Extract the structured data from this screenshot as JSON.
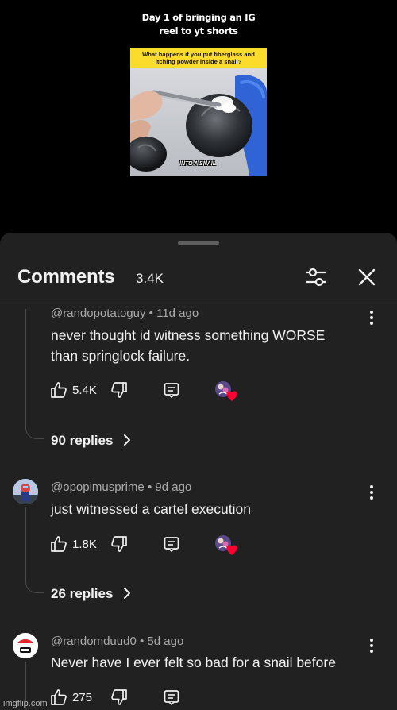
{
  "reel": {
    "title_line1": "Day 1 of bringing an IG",
    "title_line2": "reel to yt shorts",
    "caption_line1": "What happens if you put fiberglass and",
    "caption_line2": "itching powder inside a snail?",
    "subtitle": "INTO A SNAIL"
  },
  "comments_panel": {
    "title": "Comments",
    "count": "3.4K",
    "filter_icon": "sliders-icon",
    "close_icon": "close-icon"
  },
  "comments": [
    {
      "author": "@randopotatoguy",
      "separator": "•",
      "age": "11d ago",
      "text_line1": "never thought id witness something WORSE",
      "text_line2": "than springlock failure.",
      "likes": "5.4K",
      "replies": "90 replies"
    },
    {
      "author": "@opopimusprime",
      "separator": "•",
      "age": "9d ago",
      "text_line1": "just witnessed a cartel execution",
      "likes": "1.8K",
      "replies": "26 replies"
    },
    {
      "author": "@randomduud0",
      "separator": "•",
      "age": "5d ago",
      "text_line1": "Never have I ever felt so bad for a snail before",
      "likes": "275"
    }
  ],
  "watermark": "imgflip.com",
  "colors": {
    "sheet_bg": "#212121",
    "text_primary": "#f1f1f1",
    "text_secondary": "#aaaaaa",
    "heart": "#ff0033",
    "caption_yellow": "#fbdc2c"
  }
}
